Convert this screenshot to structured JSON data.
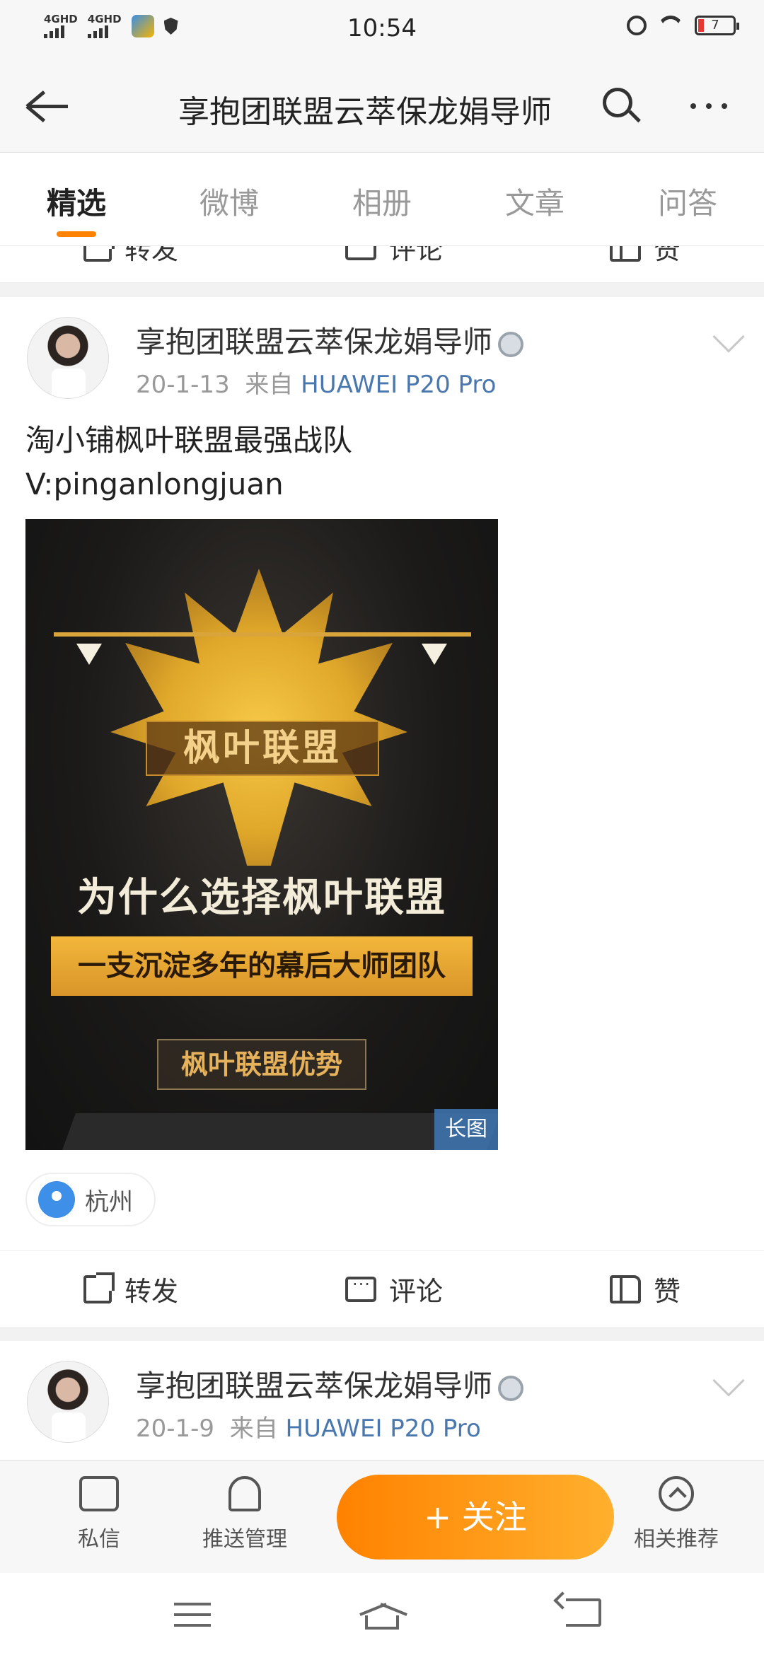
{
  "status_bar": {
    "network_1": "4GHD",
    "network_2": "4GHD",
    "time": "10:54",
    "battery_level": "7"
  },
  "header": {
    "title": "享抱团联盟云萃保龙娟导师"
  },
  "tabs": [
    {
      "label": "精选",
      "active": true
    },
    {
      "label": "微博",
      "active": false
    },
    {
      "label": "相册",
      "active": false
    },
    {
      "label": "文章",
      "active": false
    },
    {
      "label": "问答",
      "active": false
    }
  ],
  "actions": {
    "repost": "转发",
    "comment": "评论",
    "like": "赞"
  },
  "post1": {
    "author": "享抱团联盟云萃保龙娟导师",
    "date": "20-1-13",
    "from_label": "来自",
    "source": "HUAWEI P20 Pro",
    "text_line1": "淘小铺枫叶联盟最强战队",
    "text_line2": "V:pinganlongjuan",
    "image": {
      "brand": "枫叶联盟",
      "headline": "为什么选择枫叶联盟",
      "band": "一支沉淀多年的幕后大师团队",
      "sub": "枫叶联盟优势",
      "badge": "长图"
    },
    "location": "杭州"
  },
  "post2": {
    "author": "享抱团联盟云萃保龙娟导师",
    "date": "20-1-9",
    "from_label": "来自",
    "source": "HUAWEI P20 Pro"
  },
  "bottom_bar": {
    "message": "私信",
    "push": "推送管理",
    "follow": "+ 关注",
    "related": "相关推荐"
  },
  "colors": {
    "accent": "#ff8200",
    "source_link": "#4a78ae"
  }
}
